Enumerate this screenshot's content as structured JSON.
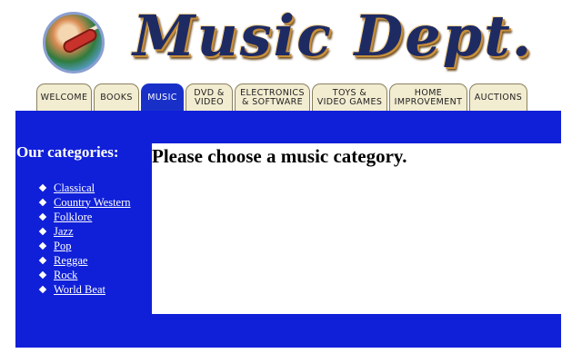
{
  "header": {
    "title": "Music Dept.",
    "logo_icon": "guitar-logo-icon"
  },
  "tabs": [
    {
      "label": "WELCOME",
      "active": false
    },
    {
      "label": "BOOKS",
      "active": false
    },
    {
      "label": "MUSIC",
      "active": true
    },
    {
      "label": "DVD &\nVIDEO",
      "active": false
    },
    {
      "label": "ELECTRONICS\n& SOFTWARE",
      "active": false
    },
    {
      "label": "TOYS &\nVIDEO GAMES",
      "active": false
    },
    {
      "label": "HOME\nIMPROVEMENT",
      "active": false
    },
    {
      "label": "AUCTIONS",
      "active": false
    }
  ],
  "sidebar": {
    "title": "Our categories:",
    "categories": [
      "Classical",
      "Country Western",
      "Folklore",
      "Jazz",
      "Pop",
      "Reggae",
      "Rock",
      "World Beat"
    ]
  },
  "main": {
    "heading": "Please choose a music category."
  },
  "colors": {
    "band_blue": "#1020d8",
    "active_tab": "#1830c8",
    "tab_bg": "#f2ecd0"
  }
}
